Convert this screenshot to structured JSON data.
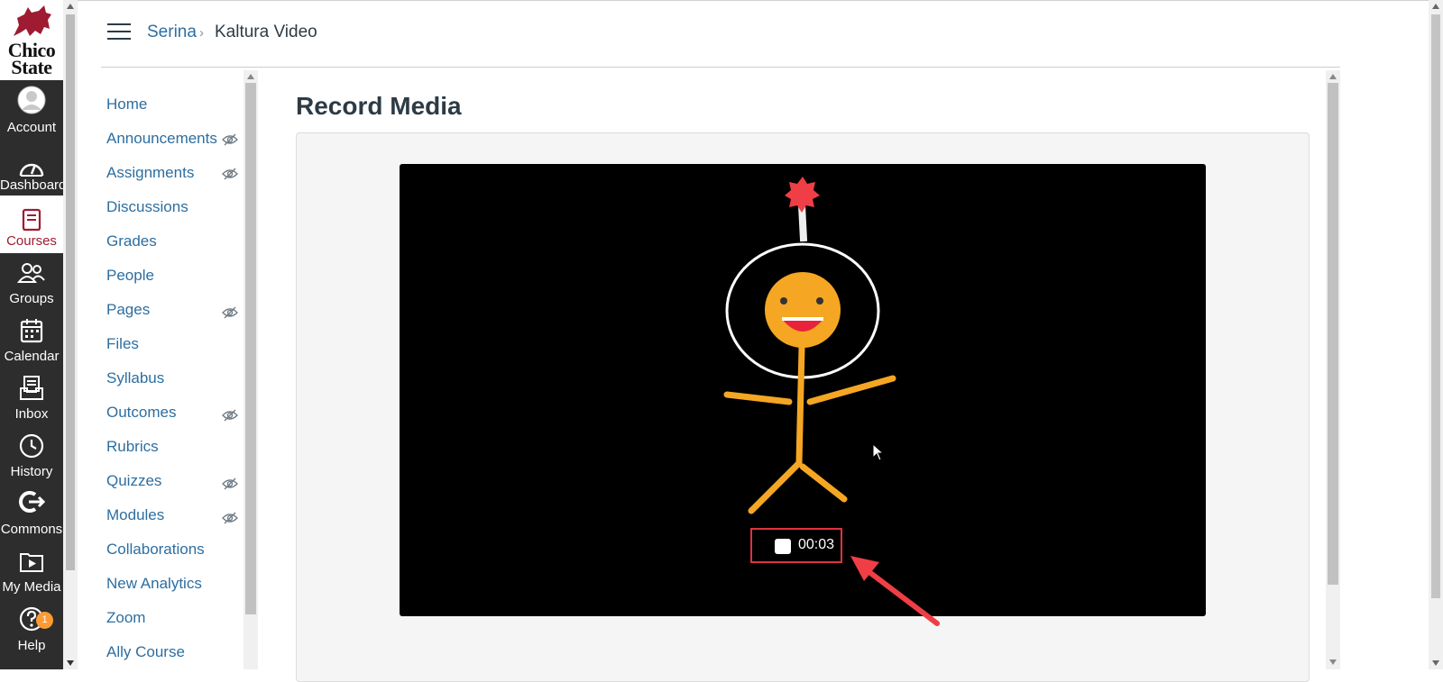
{
  "brand": {
    "logo_line1": "Chico",
    "logo_line2": "State",
    "primary_color": "#9e1b32",
    "nav_bg": "#2d2d2d"
  },
  "global_nav": [
    {
      "label": "Account",
      "icon": "account-icon"
    },
    {
      "label": "Dashboard",
      "icon": "dashboard-icon"
    },
    {
      "label": "Courses",
      "icon": "courses-icon",
      "active": true
    },
    {
      "label": "Groups",
      "icon": "groups-icon"
    },
    {
      "label": "Calendar",
      "icon": "calendar-icon"
    },
    {
      "label": "Inbox",
      "icon": "inbox-icon"
    },
    {
      "label": "History",
      "icon": "history-icon"
    },
    {
      "label": "Commons",
      "icon": "commons-icon"
    },
    {
      "label": "My Media",
      "icon": "my-media-icon"
    },
    {
      "label": "Help",
      "icon": "help-icon",
      "badge": "1"
    }
  ],
  "breadcrumb": {
    "course": "Serina",
    "separator": "›",
    "page": "Kaltura Video"
  },
  "course_nav": [
    {
      "label": "Home",
      "hidden": false
    },
    {
      "label": "Announcements",
      "hidden": true
    },
    {
      "label": "Assignments",
      "hidden": true
    },
    {
      "label": "Discussions",
      "hidden": false
    },
    {
      "label": "Grades",
      "hidden": false
    },
    {
      "label": "People",
      "hidden": false
    },
    {
      "label": "Pages",
      "hidden": true
    },
    {
      "label": "Files",
      "hidden": false
    },
    {
      "label": "Syllabus",
      "hidden": false
    },
    {
      "label": "Outcomes",
      "hidden": true
    },
    {
      "label": "Rubrics",
      "hidden": false
    },
    {
      "label": "Quizzes",
      "hidden": true
    },
    {
      "label": "Modules",
      "hidden": true
    },
    {
      "label": "Collaborations",
      "hidden": false
    },
    {
      "label": "New Analytics",
      "hidden": false
    },
    {
      "label": "Zoom",
      "hidden": false
    },
    {
      "label": "Ally Course",
      "hidden": false
    }
  ],
  "main": {
    "title": "Record Media",
    "recorder": {
      "timer": "00:03",
      "highlight_color": "#e0323c"
    }
  }
}
